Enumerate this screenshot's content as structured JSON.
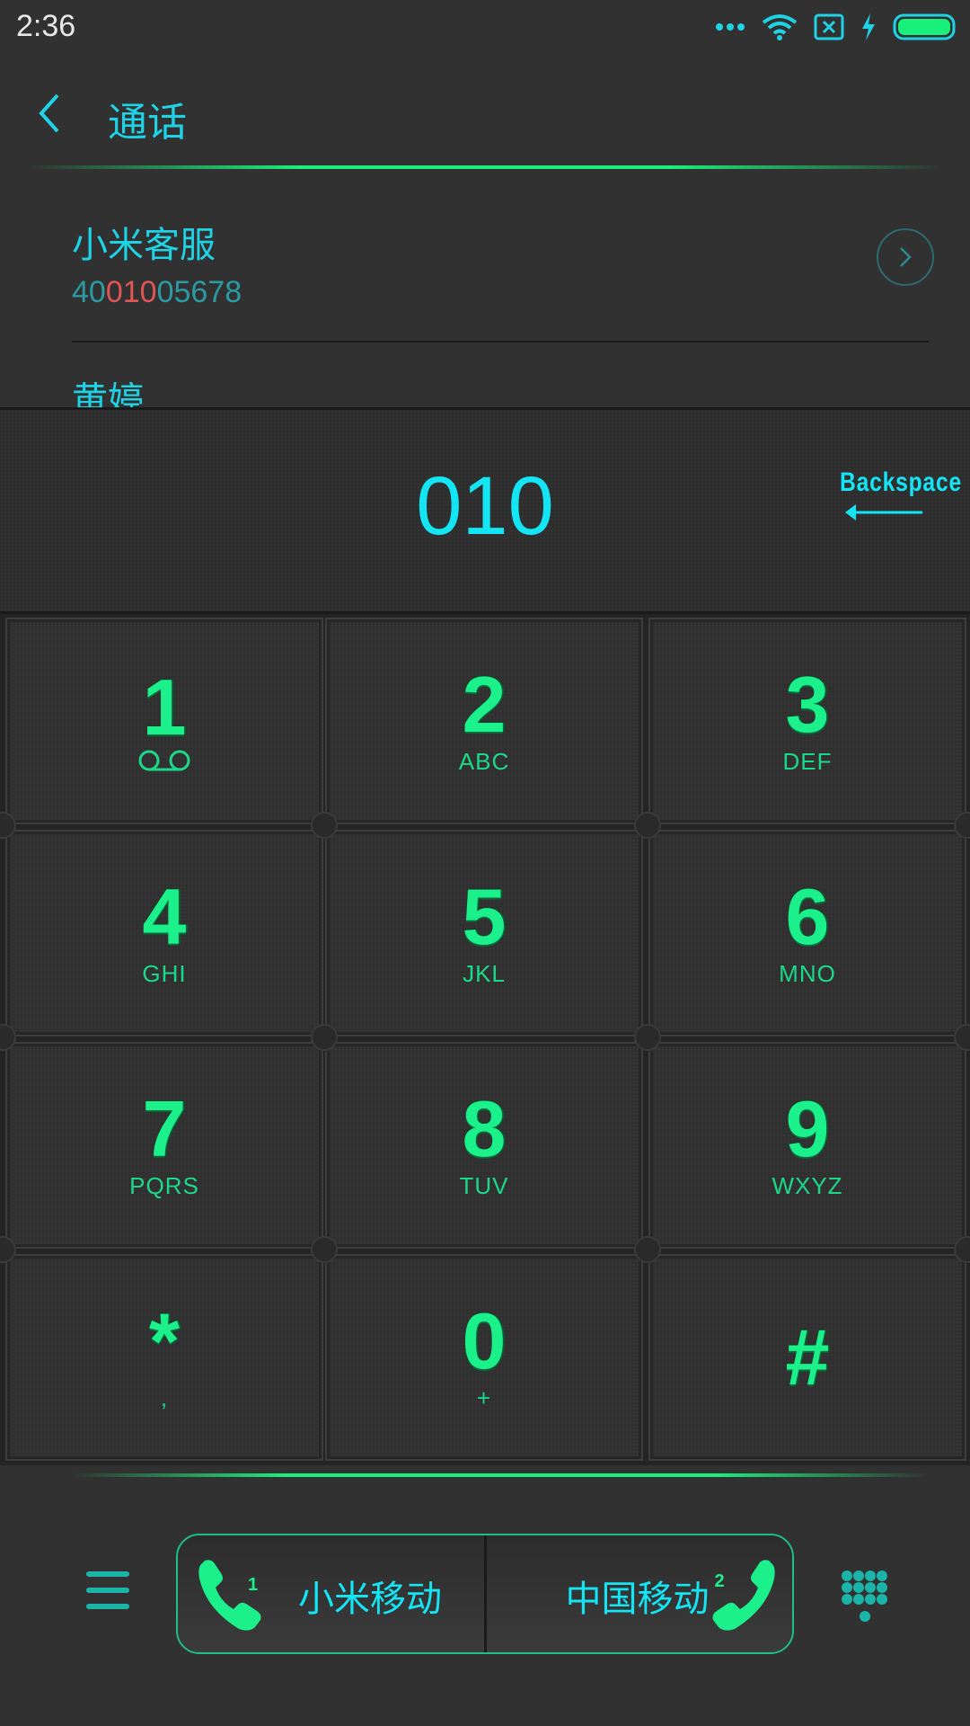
{
  "status_bar": {
    "time": "2:36"
  },
  "header": {
    "title": "通话"
  },
  "contacts": [
    {
      "name": "小米客服",
      "number_prefix": "40",
      "number_match": "010",
      "number_suffix": "05678"
    },
    {
      "name": "黄婷"
    }
  ],
  "dialer": {
    "input_value": "010",
    "backspace_label": "Backspace"
  },
  "keys": [
    {
      "digit": "1",
      "sub": ""
    },
    {
      "digit": "2",
      "sub": "ABC"
    },
    {
      "digit": "3",
      "sub": "DEF"
    },
    {
      "digit": "4",
      "sub": "GHI"
    },
    {
      "digit": "5",
      "sub": "JKL"
    },
    {
      "digit": "6",
      "sub": "MNO"
    },
    {
      "digit": "7",
      "sub": "PQRS"
    },
    {
      "digit": "8",
      "sub": "TUV"
    },
    {
      "digit": "9",
      "sub": "WXYZ"
    },
    {
      "digit": "*",
      "sub": ","
    },
    {
      "digit": "0",
      "sub": "+"
    },
    {
      "digit": "#",
      "sub": ""
    }
  ],
  "call_buttons": [
    {
      "label": "小米移动",
      "sim": "1"
    },
    {
      "label": "中国移动",
      "sim": "2"
    }
  ],
  "colors": {
    "accent_cyan": "#14e5f5",
    "accent_green": "#1cf08a",
    "match_red": "#e05555",
    "background": "#313131"
  }
}
